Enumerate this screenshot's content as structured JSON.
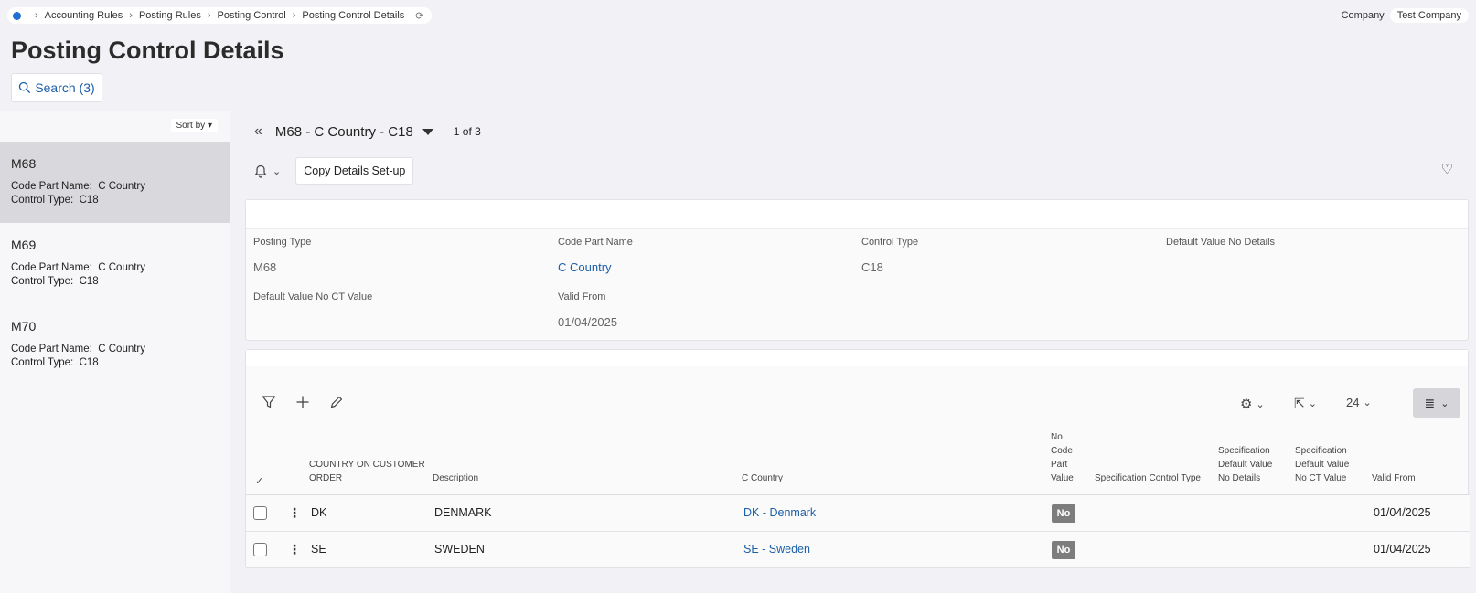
{
  "breadcrumb": {
    "items": [
      "Accounting Rules",
      "Posting Rules",
      "Posting Control",
      "Posting Control Details"
    ]
  },
  "company": {
    "label": "Company",
    "value": "Test Company"
  },
  "page": {
    "title": "Posting Control Details",
    "search_label": "Search (3)"
  },
  "list": {
    "sort_label": "Sort by",
    "items": [
      {
        "title": "M68",
        "code_part_label": "Code Part Name:",
        "code_part": "C Country",
        "control_type_label": "Control Type:",
        "control_type": "C18"
      },
      {
        "title": "M69",
        "code_part_label": "Code Part Name:",
        "code_part": "C Country",
        "control_type_label": "Control Type:",
        "control_type": "C18"
      },
      {
        "title": "M70",
        "code_part_label": "Code Part Name:",
        "code_part": "C Country",
        "control_type_label": "Control Type:",
        "control_type": "C18"
      }
    ]
  },
  "record": {
    "name": "M68 - C Country - C18",
    "position": "1 of 3",
    "copy_button": "Copy Details Set-up"
  },
  "details": {
    "posting_type_label": "Posting Type",
    "posting_type": "M68",
    "code_part_name_label": "Code Part Name",
    "code_part_name": "C Country",
    "control_type_label": "Control Type",
    "control_type": "C18",
    "default_no_details_label": "Default Value No Details",
    "default_no_ct_label": "Default Value No CT Value",
    "valid_from_label": "Valid From",
    "valid_from": "01/04/2025"
  },
  "table": {
    "page_size": "24",
    "headers": {
      "country_l1": "COUNTRY ON CUSTOMER",
      "country_l2": "ORDER",
      "description": "Description",
      "c_country": "C Country",
      "no_code_l1": "No",
      "no_code_l2": "Code",
      "no_code_l3": "Part",
      "no_code_l4": "Value",
      "spec_ct": "Specification Control Type",
      "spec_nd_l1": "Specification",
      "spec_nd_l2": "Default Value",
      "spec_nd_l3": "No Details",
      "spec_nct_l1": "Specification",
      "spec_nct_l2": "Default Value",
      "spec_nct_l3": "No CT Value",
      "valid_from": "Valid From"
    },
    "rows": [
      {
        "country": "DK",
        "description": "DENMARK",
        "c_country": "DK - Denmark",
        "no_code": "No",
        "valid_from": "01/04/2025"
      },
      {
        "country": "SE",
        "description": "SWEDEN",
        "c_country": "SE - Sweden",
        "no_code": "No",
        "valid_from": "01/04/2025"
      }
    ]
  },
  "colors": {
    "accent": "#1f6ed4",
    "link": "#1c5fa8",
    "badge": "#7d7d7d",
    "active_row": "#d9d9dd"
  }
}
